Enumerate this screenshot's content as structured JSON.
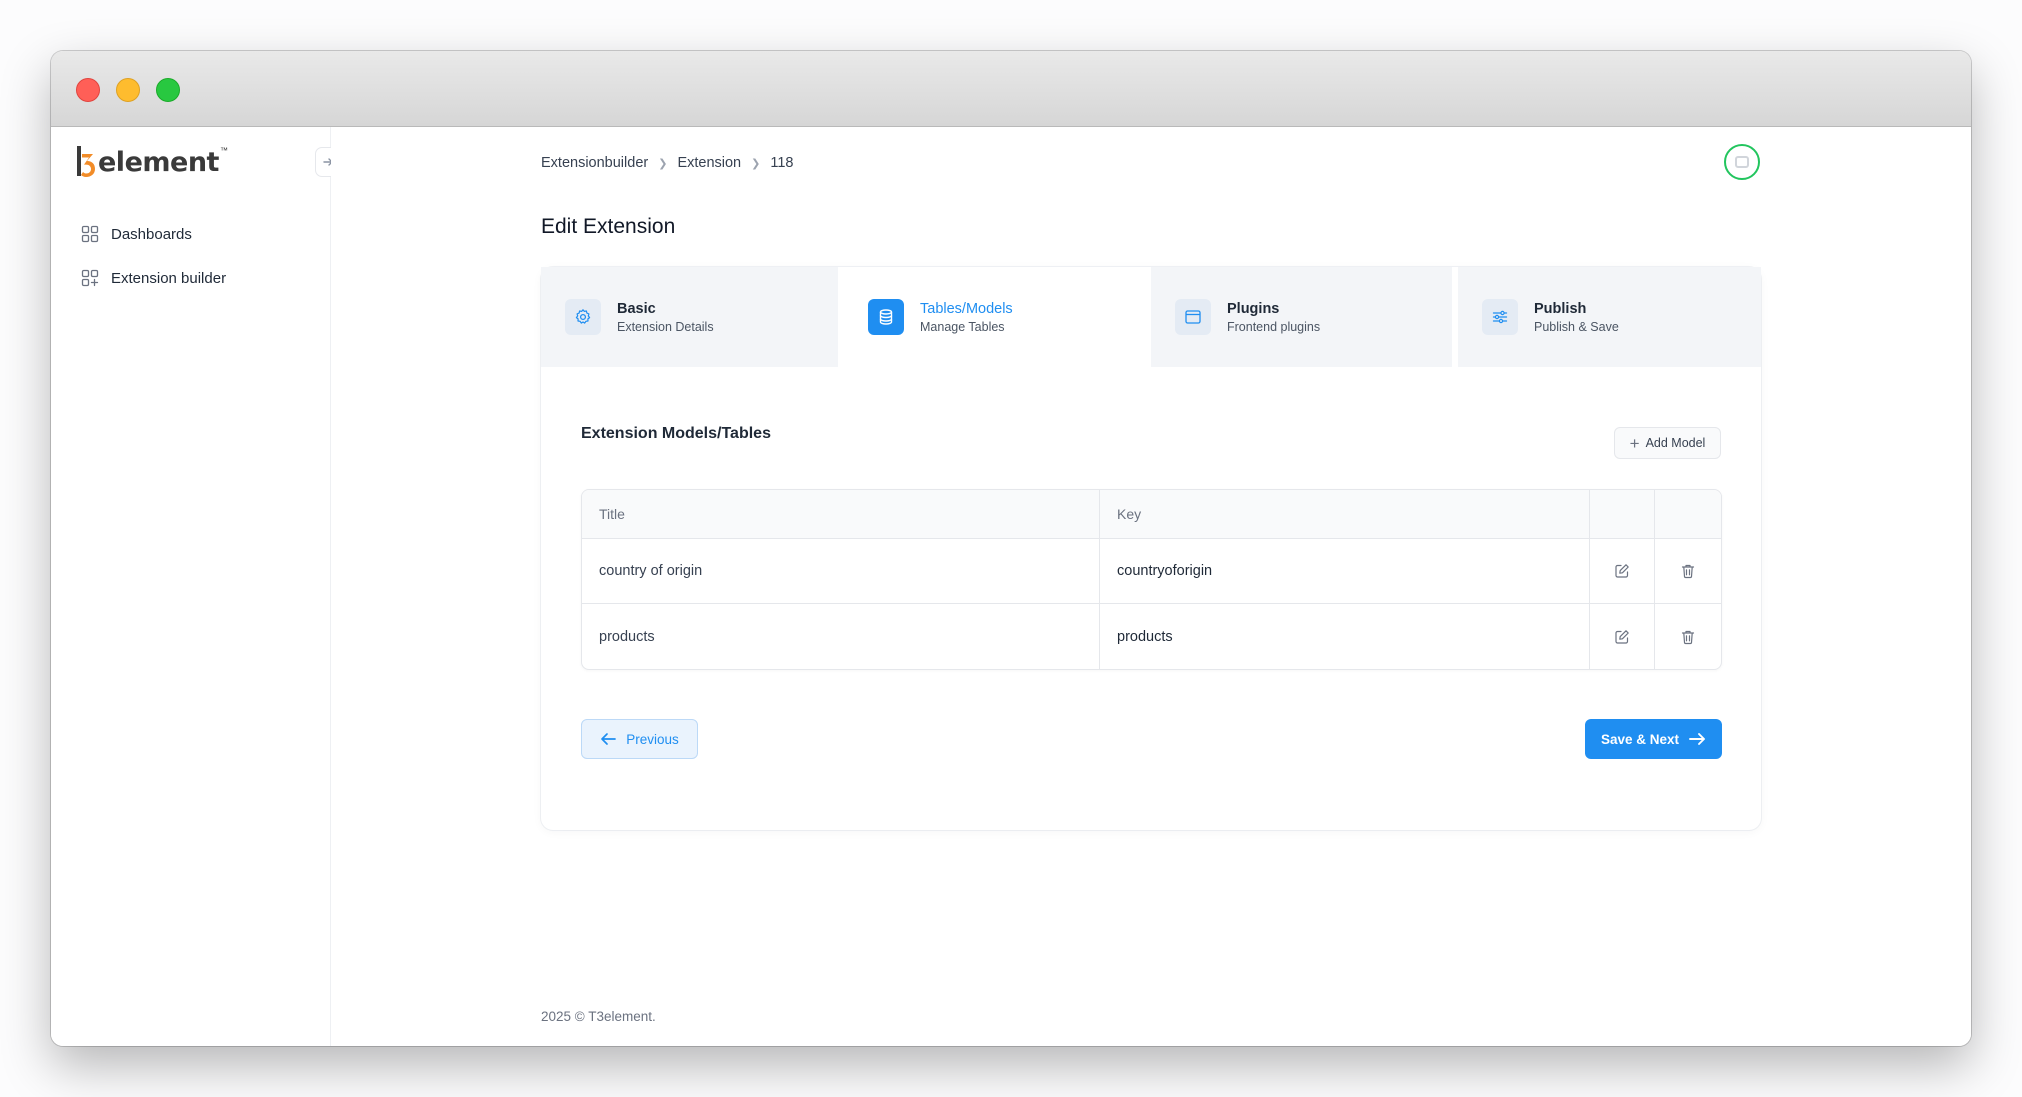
{
  "app": {
    "logo_text": "element",
    "logo_tm": "™"
  },
  "sidebar": {
    "items": [
      {
        "label": "Dashboards",
        "icon": "grid-icon"
      },
      {
        "label": "Extension builder",
        "icon": "grid-plus-icon"
      }
    ]
  },
  "breadcrumb": [
    "Extensionbuilder",
    "Extension",
    "118"
  ],
  "page_title": "Edit Extension",
  "steps": [
    {
      "title": "Basic",
      "subtitle": "Extension Details",
      "icon": "gear-icon",
      "active": false
    },
    {
      "title": "Tables/Models",
      "subtitle": "Manage Tables",
      "icon": "database-icon",
      "active": true
    },
    {
      "title": "Plugins",
      "subtitle": "Frontend plugins",
      "icon": "window-icon",
      "active": false
    },
    {
      "title": "Publish",
      "subtitle": "Publish & Save",
      "icon": "sliders-icon",
      "active": false
    }
  ],
  "section": {
    "title": "Extension Models/Tables",
    "add_label": "Add Model"
  },
  "table": {
    "columns": [
      "Title",
      "Key"
    ],
    "rows": [
      {
        "title": "country of origin",
        "key": "countryoforigin"
      },
      {
        "title": "products",
        "key": "products"
      }
    ]
  },
  "actions": {
    "previous_label": "Previous",
    "next_label": "Save & Next"
  },
  "footer": {
    "text": "2025 ©  T3element."
  },
  "colors": {
    "accent": "#1f8ef1",
    "avatar_ring": "#22c55e"
  }
}
